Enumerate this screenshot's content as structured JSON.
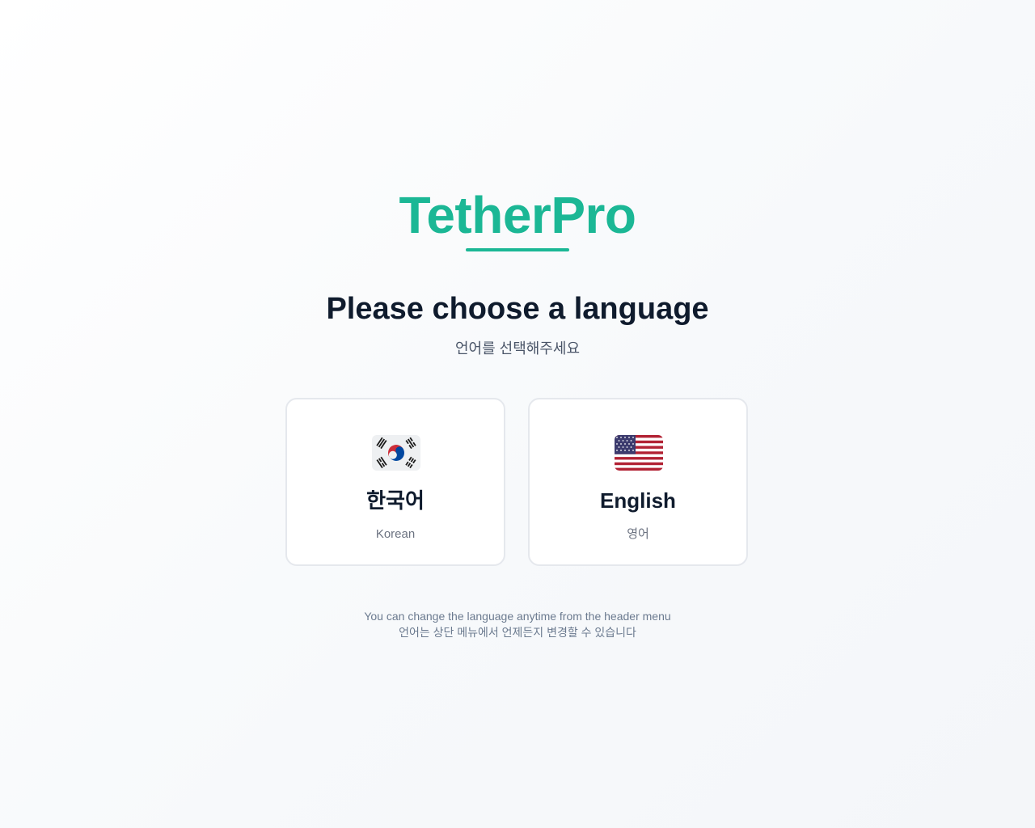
{
  "brand": {
    "name": "TetherPro",
    "color": "#1bb795"
  },
  "heading": "Please choose a language",
  "subheading": "언어를 선택해주세요",
  "languages": [
    {
      "flag_icon": "south-korea-flag-icon",
      "title": "한국어",
      "subtitle": "Korean"
    },
    {
      "flag_icon": "united-states-flag-icon",
      "title": "English",
      "subtitle": "영어"
    }
  ],
  "footer": {
    "line1": "You can change the language anytime from the header menu",
    "line2": "언어는 상단 메뉴에서 언제든지 변경할 수 있습니다"
  }
}
